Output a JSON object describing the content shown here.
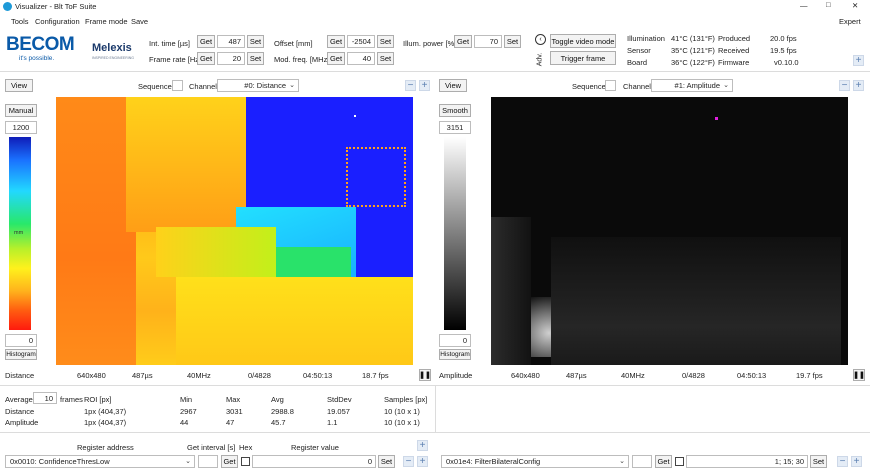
{
  "window": {
    "title": "Visualizer - Blt ToF Suite",
    "controls": {
      "minimize": "—",
      "maximize": "□",
      "close": "✕"
    }
  },
  "menu": {
    "items": [
      "Tools",
      "Configuration",
      "Frame mode",
      "Save"
    ],
    "expert": "Expert"
  },
  "brand": {
    "becom": "BECOM",
    "becom_tag": "it's possible.",
    "melexis": "Melexis",
    "melexis_tag": "INSPIRED ENGINEERING"
  },
  "controls": {
    "get_label": "Get",
    "set_label": "Set",
    "int_time_label": "Int. time [µs]",
    "int_time_value": "487",
    "frame_rate_label": "Frame rate [Hz]",
    "frame_rate_value": "20",
    "offset_label": "Offset [mm]",
    "offset_value": "-2504",
    "mod_freq_label": "Mod. freq. [MHz]",
    "mod_freq_value": "40",
    "illum_label": "Illum. power [%]",
    "illum_value": "70",
    "adv_label": "Adv.",
    "toggle_video": "Toggle video mode",
    "trigger_frame": "Trigger frame"
  },
  "status": {
    "illumination_label": "Illumination",
    "illumination_value": "41°C (131°F)",
    "sensor_label": "Sensor",
    "sensor_value": "35°C (121°F)",
    "board_label": "Board",
    "board_value": "36°C (122°F)",
    "produced_label": "Produced",
    "produced_value": "20.0 fps",
    "received_label": "Received",
    "received_value": "19.5 fps",
    "firmware_label": "Firmware",
    "firmware_value": "v0.10.0"
  },
  "left_view": {
    "view_btn": "View",
    "sequence_label": "Sequence",
    "channel_label": "Channel",
    "channel_value": "#0: Distance",
    "mode_btn": "Manual",
    "scale_max": "1200",
    "scale_unit": "mm",
    "scale_min": "0",
    "histogram_btn": "Histogram",
    "footer": {
      "name": "Distance",
      "resolution": "640x480",
      "int_time": "487µs",
      "freq": "40MHz",
      "frames": "0/4828",
      "time": "04:50:13",
      "fps": "18.7 fps"
    }
  },
  "right_view": {
    "view_btn": "View",
    "sequence_label": "Sequence",
    "channel_label": "Channel",
    "channel_value": "#1: Amplitude",
    "mode_btn": "Smooth",
    "scale_max": "3151",
    "scale_min": "0",
    "histogram_btn": "Histogram",
    "footer": {
      "name": "Amplitude",
      "resolution": "640x480",
      "int_time": "487µs",
      "freq": "40MHz",
      "frames": "0/4828",
      "time": "04:50:13",
      "fps": "19.7 fps"
    }
  },
  "stats": {
    "average_label": "Average",
    "average_value": "10",
    "frames_label": "frames",
    "headers": [
      "ROI [px]",
      "Min",
      "Max",
      "Avg",
      "StdDev",
      "Samples [px]"
    ],
    "rows": [
      {
        "name": "Distance",
        "roi": "1px (404,37)",
        "min": "2967",
        "max": "3031",
        "avg": "2988.8",
        "std": "19.057",
        "samples": "10 (10 x 1)"
      },
      {
        "name": "Amplitude",
        "roi": "1px (404,37)",
        "min": "44",
        "max": "47",
        "avg": "45.7",
        "std": "1.1",
        "samples": "10 (10 x 1)"
      }
    ]
  },
  "registers": {
    "address_label": "Register address",
    "interval_label": "Get interval [s]",
    "hex_label": "Hex",
    "value_label": "Register value",
    "left": {
      "address": "0x0010: ConfidenceThresLow",
      "value": "0"
    },
    "right": {
      "address": "0x01e4: FilterBilateralConfig",
      "value": "1; 15; 30"
    }
  },
  "colors": {
    "accent": "#0a5aa8",
    "plus_bg": "#e4ecf6",
    "dark_image": "#0a0a0a"
  }
}
